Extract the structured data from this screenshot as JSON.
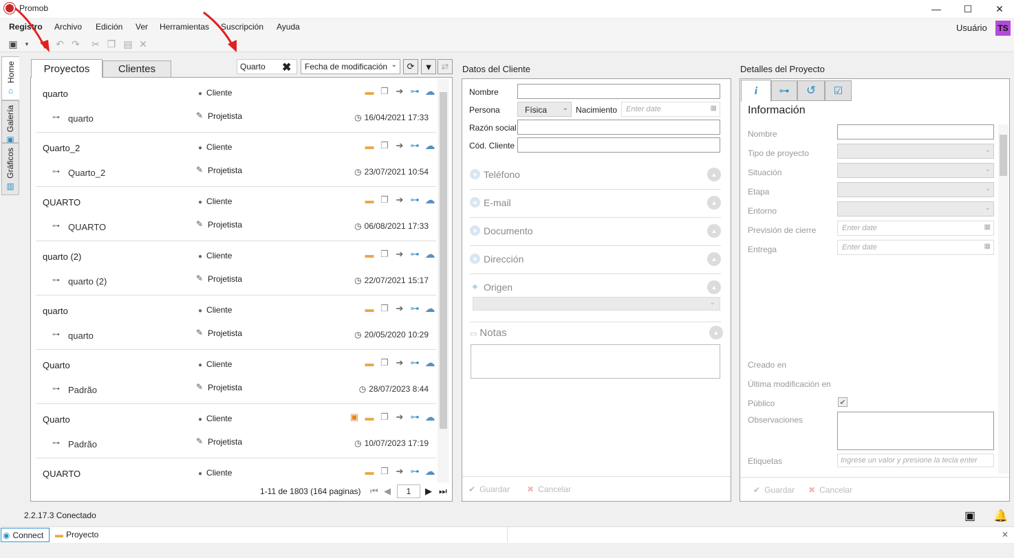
{
  "app": {
    "title": "Promob"
  },
  "window": {
    "minimize": "—",
    "maximize": "☐",
    "close": "✕"
  },
  "menu": [
    "Registro",
    "Archivo",
    "Edición",
    "Ver",
    "Herramientas",
    "Suscripción",
    "Ayuda"
  ],
  "user": {
    "label": "Usuário",
    "initials": "TS"
  },
  "side_tabs": [
    "Home",
    "Galería",
    "Gráficos"
  ],
  "projects_panel": {
    "tabs": [
      "Proyectos",
      "Clientes"
    ],
    "search_value": "Quarto",
    "sort_value": "Fecha de modificación",
    "rows": [
      {
        "name": "quarto",
        "client": "Cliente",
        "sub": "quarto",
        "designer": "Projetista",
        "date": "16/04/2021 17:33",
        "has_person": false
      },
      {
        "name": "Quarto_2",
        "client": "Cliente",
        "sub": "Quarto_2",
        "designer": "Projetista",
        "date": "23/07/2021 10:54",
        "has_person": false
      },
      {
        "name": "QUARTO",
        "client": "Cliente",
        "sub": "QUARTO",
        "designer": "Projetista",
        "date": "06/08/2021 17:33",
        "has_person": false
      },
      {
        "name": "quarto (2)",
        "client": "Cliente",
        "sub": "quarto (2)",
        "designer": "Projetista",
        "date": "22/07/2021 15:17",
        "has_person": false
      },
      {
        "name": "quarto",
        "client": "Cliente",
        "sub": "quarto",
        "designer": "Projetista",
        "date": "20/05/2020 10:29",
        "has_person": false
      },
      {
        "name": "Quarto",
        "client": "Cliente",
        "sub": "Padrão",
        "designer": "Projetista",
        "date": "28/07/2023 8:44",
        "has_person": false
      },
      {
        "name": "Quarto",
        "client": "Cliente",
        "sub": "Padrão",
        "designer": "Projetista",
        "date": "10/07/2023 17:19",
        "has_person": true
      },
      {
        "name": "QUARTO",
        "client": "Cliente",
        "sub": "",
        "designer": "",
        "date": "",
        "has_person": false
      }
    ],
    "pagination": {
      "text": "1-11 de 1803 (164 paginas)",
      "page": "1"
    }
  },
  "client_panel": {
    "title": "Datos del Cliente",
    "nombre_label": "Nombre",
    "persona_label": "Persona",
    "persona_value": "Física",
    "nacimiento_label": "Nacimiento",
    "nacimiento_placeholder": "Enter date",
    "razon_label": "Razón social",
    "cod_label": "Cód. Cliente",
    "sections": [
      "Teléfono",
      "E-mail",
      "Documento",
      "Dirección",
      "Origen"
    ],
    "notas_label": "Notas",
    "save": "Guardar",
    "cancel": "Cancelar"
  },
  "project_panel": {
    "title": "Detalles del Proyecto",
    "section_title": "Información",
    "fields": [
      "Nombre",
      "Tipo de proyecto",
      "Situación",
      "Etapa",
      "Entorno",
      "Previsión de cierre",
      "Entrega"
    ],
    "date_placeholder": "Enter date",
    "creado": "Creado en",
    "ultima": "Última modificación en",
    "publico": "Público",
    "observaciones": "Observaciones",
    "etiquetas": "Etiquetas",
    "etiquetas_placeholder": "Ingrese un valor y presione la tecla enter",
    "save": "Guardar",
    "cancel": "Cancelar"
  },
  "status": {
    "version": "2.2.17.3",
    "state": "Conectado"
  },
  "bottom_tabs": [
    "Connect",
    "Proyecto"
  ]
}
